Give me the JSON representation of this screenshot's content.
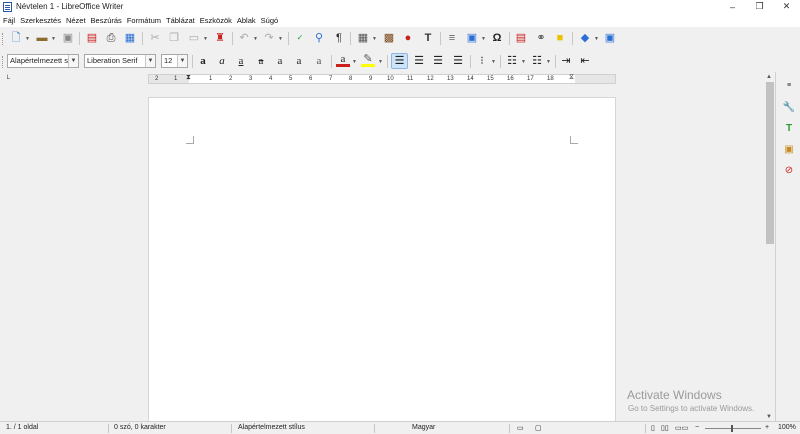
{
  "window": {
    "title": "Névtelen 1 - LibreOffice Writer",
    "minimize": "–",
    "maximize": "❐",
    "close": "✕",
    "doc_close": "✕"
  },
  "menu": [
    "Fájl",
    "Szerkesztés",
    "Nézet",
    "Beszúrás",
    "Formátum",
    "Táblázat",
    "Eszközök",
    "Ablak",
    "Súgó"
  ],
  "formatting": {
    "paragraph_style": "Alapértelmezett stíl",
    "font_name": "Liberation Serif",
    "font_size": "12"
  },
  "ruler": {
    "left_numbers": [
      "2",
      "1"
    ],
    "right_numbers": [
      "1",
      "2",
      "3",
      "4",
      "5",
      "6",
      "7",
      "8",
      "9",
      "10",
      "11",
      "12",
      "13",
      "14",
      "15",
      "16",
      "17",
      "18"
    ]
  },
  "watermark": {
    "title": "Activate Windows",
    "subtitle": "Go to Settings to activate Windows."
  },
  "status": {
    "page": "1. / 1 oldal",
    "words": "0 szó, 0 karakter",
    "style": "Alapértelmezett stílus",
    "language": "Magyar",
    "zoom": "100%",
    "zoom_minus": "−",
    "zoom_plus": "+"
  },
  "colors": {
    "font_color": "#c9211e",
    "highlight": "#ffff00",
    "accent": "#2a6fd6"
  },
  "icons": {
    "toolbar1": [
      "new-document-icon",
      "open-icon",
      "save-icon",
      "export-pdf-icon",
      "print-icon",
      "print-preview-icon",
      "cut-icon",
      "copy-icon",
      "paste-icon",
      "clone-formatting-icon",
      "undo-icon",
      "redo-icon",
      "spellcheck-icon",
      "find-replace-icon",
      "formatting-marks-icon",
      "insert-table-icon",
      "insert-image-icon",
      "insert-chart-icon",
      "insert-textbox-icon",
      "insert-page-break-icon",
      "insert-field-icon",
      "special-character-icon",
      "insert-hyperlink-icon",
      "insert-footnote-icon",
      "insert-comment-icon",
      "basic-shapes-icon",
      "draw-functions-icon"
    ],
    "toolbar2": [
      "bold-icon",
      "italic-icon",
      "underline-icon",
      "strikethrough-icon",
      "superscript-icon",
      "subscript-icon",
      "shadow-icon",
      "font-color-icon",
      "highlight-icon",
      "align-left-icon",
      "align-center-icon",
      "align-right-icon",
      "justify-icon",
      "line-spacing-icon",
      "bullets-icon",
      "numbering-icon",
      "increase-indent-icon",
      "decrease-indent-icon"
    ],
    "sidebar": [
      "sidebar-menu-icon",
      "properties-icon",
      "styles-icon",
      "gallery-icon",
      "navigator-icon"
    ]
  }
}
